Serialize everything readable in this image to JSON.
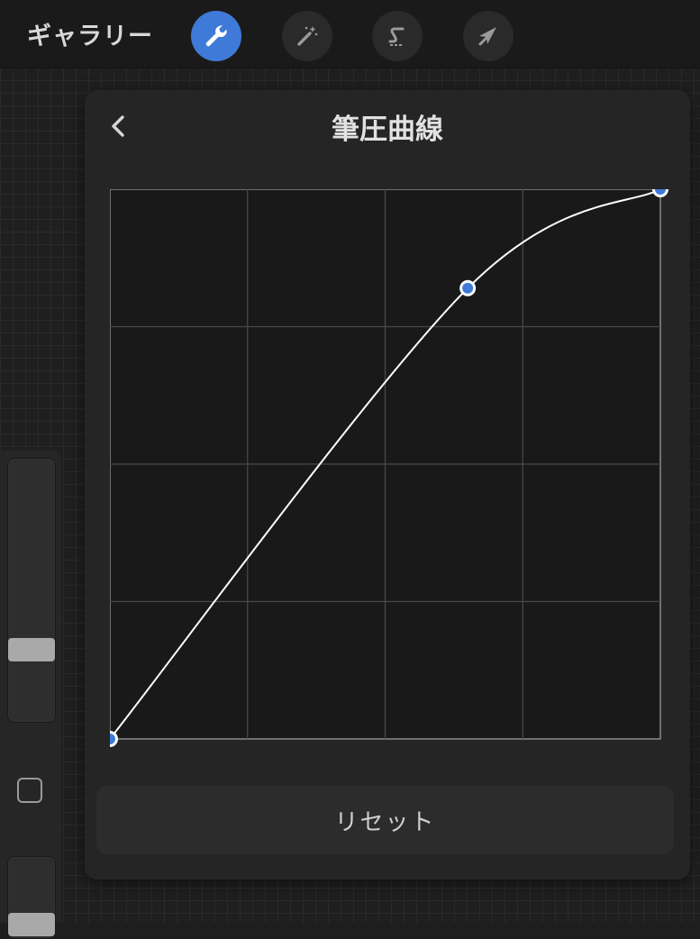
{
  "topbar": {
    "gallery_label": "ギャラリー",
    "tools": [
      {
        "name": "actions",
        "icon": "wrench-icon",
        "active": true
      },
      {
        "name": "adjustments",
        "icon": "magic-wand-icon",
        "active": false
      },
      {
        "name": "selection",
        "icon": "selection-s-icon",
        "active": false
      },
      {
        "name": "transform",
        "icon": "arrow-cursor-icon",
        "active": false
      }
    ]
  },
  "panel": {
    "title": "筆圧曲線",
    "back_icon": "chevron-left-icon",
    "reset_label": "リセット"
  },
  "curve": {
    "x_range": [
      0,
      1
    ],
    "y_range": [
      0,
      1
    ],
    "grid_divisions": 4,
    "control_points": [
      {
        "x": 0.0,
        "y": 0.0
      },
      {
        "x": 0.65,
        "y": 0.82
      },
      {
        "x": 1.0,
        "y": 1.0
      }
    ]
  },
  "sidebar": {
    "brush_size_level": 0.22,
    "modifier_icon": "square-icon"
  },
  "colors": {
    "accent": "#3f7ad8",
    "curve_line": "#ffffff",
    "grid_line": "#4a4a4a",
    "plot_bg": "#191919"
  }
}
